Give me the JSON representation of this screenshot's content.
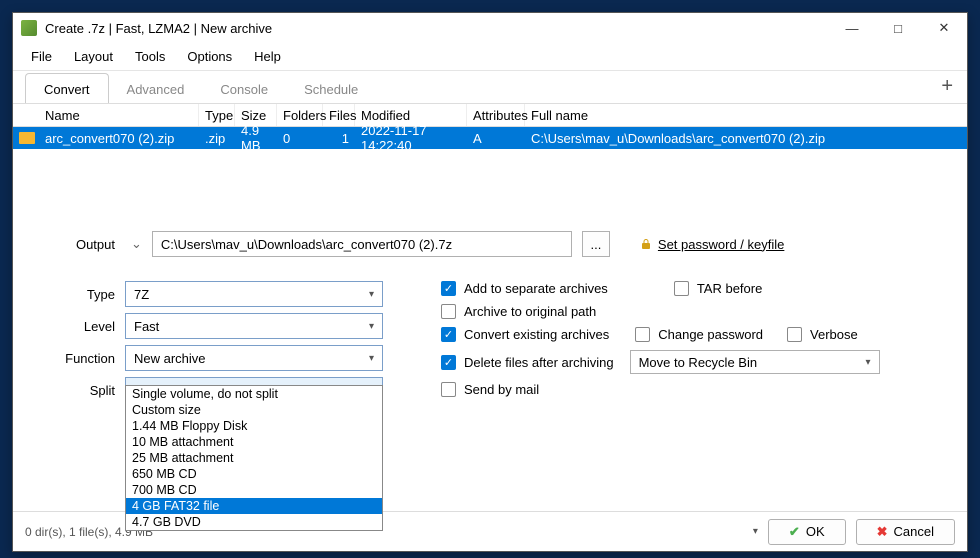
{
  "window": {
    "title": "Create .7z | Fast, LZMA2 | New archive"
  },
  "menu": [
    "File",
    "Layout",
    "Tools",
    "Options",
    "Help"
  ],
  "tabs": [
    "Convert",
    "Advanced",
    "Console",
    "Schedule"
  ],
  "file_header": {
    "name": "Name",
    "type": "Type",
    "size": "Size",
    "folders": "Folders",
    "files": "Files",
    "modified": "Modified",
    "attributes": "Attributes",
    "fullname": "Full name"
  },
  "file_row": {
    "name": "arc_convert070 (2).zip",
    "type": ".zip",
    "size": "4.9 MB",
    "folders": "0",
    "files": "1",
    "modified": "2022-11-17 14:22:40",
    "attributes": "A",
    "fullname": "C:\\Users\\mav_u\\Downloads\\arc_convert070 (2).zip"
  },
  "output_label": "Output",
  "output_path": "C:\\Users\\mav_u\\Downloads\\arc_convert070 (2).7z",
  "browse": "...",
  "pw_label": "Set password / keyfile",
  "labels": {
    "type": "Type",
    "level": "Level",
    "function": "Function",
    "split": "Split"
  },
  "values": {
    "type": "7Z",
    "level": "Fast",
    "function": "New archive",
    "split": "Custom size"
  },
  "split_options": [
    "Single volume, do not split",
    "Custom size",
    "1.44 MB Floppy Disk",
    "10 MB attachment",
    "25 MB attachment",
    "650 MB CD",
    "700 MB CD",
    "4 GB FAT32 file",
    "4.7 GB DVD"
  ],
  "checks": {
    "add_separate": "Add to separate archives",
    "archive_orig": "Archive to original path",
    "convert_existing": "Convert existing archives",
    "delete_after": "Delete files after archiving",
    "send_mail": "Send by mail",
    "tar_before": "TAR before",
    "change_pw": "Change password",
    "verbose": "Verbose"
  },
  "recycle": "Move to Recycle Bin",
  "status": "0 dir(s), 1 file(s), 4.9 MB",
  "ok": "OK",
  "cancel": "Cancel"
}
